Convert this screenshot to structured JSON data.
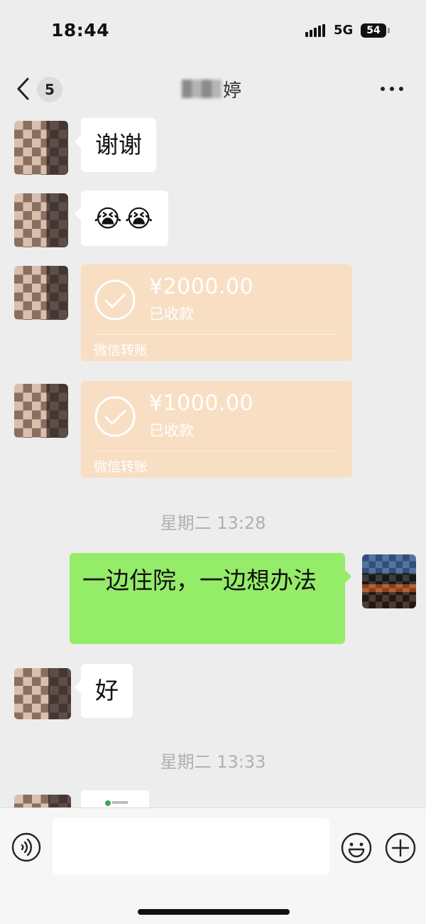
{
  "status_bar": {
    "time": "18:44",
    "network": "5G",
    "battery": "54"
  },
  "nav": {
    "back_count": "5",
    "title_visible": "婷"
  },
  "messages": {
    "m1": "谢谢",
    "m2_emojis": [
      "😭",
      "😭"
    ],
    "t1": {
      "amount": "¥2000.00",
      "status": "已收款",
      "footer": "微信转账"
    },
    "t2": {
      "amount": "¥1000.00",
      "status": "已收款",
      "footer": "微信转账"
    },
    "time1": "星期二 13:28",
    "m3": "一边住院，一边想办法",
    "m4": "好",
    "time2": "星期二 13:33"
  },
  "icons": {
    "back": "chevron-left-icon",
    "more": "more-dots-icon",
    "voice": "voice-icon",
    "emoji": "emoji-icon",
    "plus": "plus-icon"
  },
  "colors": {
    "self_bubble": "#95ec69",
    "transfer_card": "#f8dec3",
    "background": "#ededed"
  }
}
